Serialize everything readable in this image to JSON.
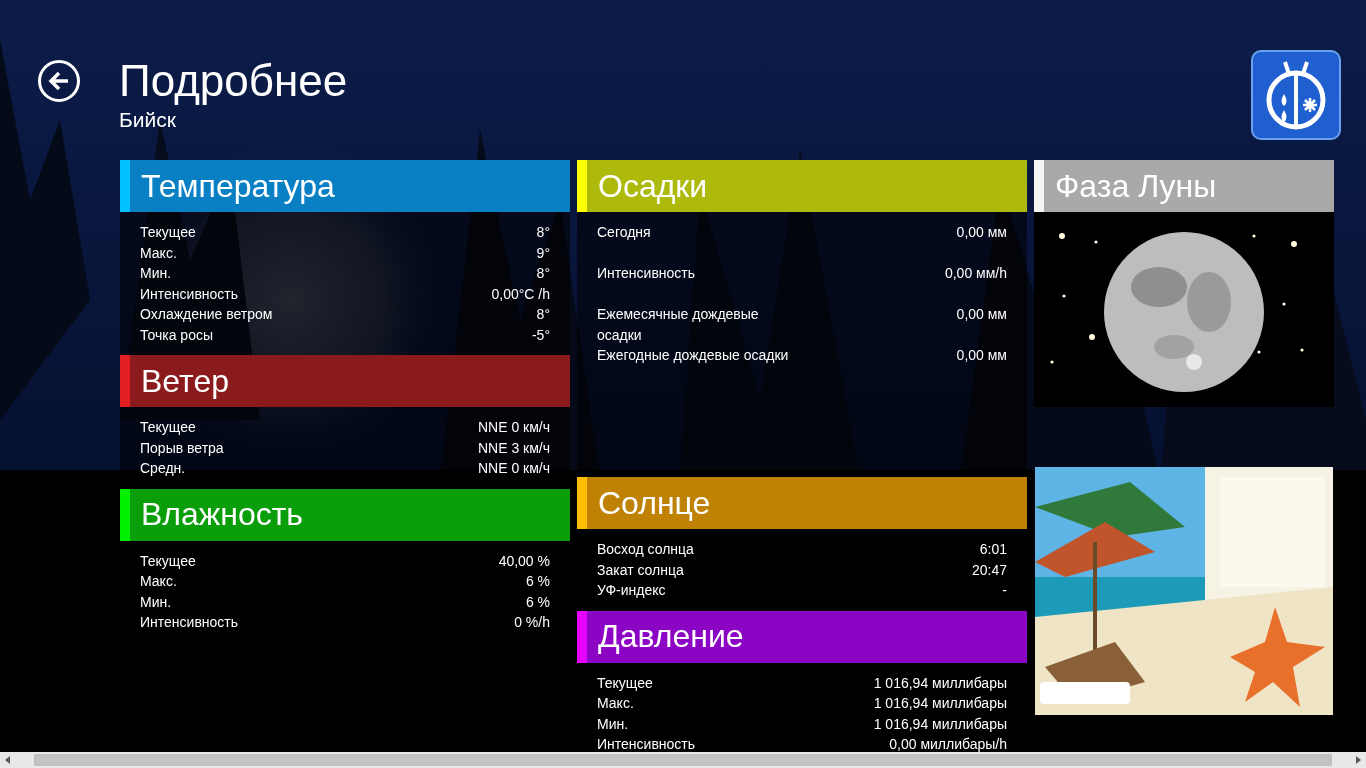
{
  "header": {
    "title": "Подробнее",
    "subtitle": "Бийск"
  },
  "columns": [
    {
      "sections": [
        {
          "kind": "stats",
          "title": "Температура",
          "color": "#0a80c4",
          "rows": [
            {
              "label": "Текущее",
              "value": "8°"
            },
            {
              "label": "Макс.",
              "value": "9°"
            },
            {
              "label": "Мин.",
              "value": "8°"
            },
            {
              "label": "Интенсивность",
              "value": "0,00°C /h"
            },
            {
              "label": "Охлаждение ветром",
              "value": "8°"
            },
            {
              "label": "Точка росы",
              "value": "-5°"
            }
          ]
        },
        {
          "kind": "stats",
          "title": "Ветер",
          "color": "#8a1a1c",
          "rows": [
            {
              "label": "Текущее",
              "value": "NNE 0 км/ч"
            },
            {
              "label": "Порыв ветра",
              "value": "NNE 3 км/ч"
            },
            {
              "label": "Средн.",
              "value": "NNE 0 км/ч"
            }
          ]
        },
        {
          "kind": "stats",
          "title": "Влажность",
          "color": "#0a9e0a",
          "rows": [
            {
              "label": "Текущее",
              "value": "40,00 %"
            },
            {
              "label": "Макс.",
              "value": "6 %"
            },
            {
              "label": "Мин.",
              "value": "6 %"
            },
            {
              "label": "Интенсивность",
              "value": "0 %/h"
            }
          ]
        }
      ]
    },
    {
      "sections": [
        {
          "kind": "spaced",
          "title": "Осадки",
          "color": "#adba0c",
          "rows": [
            {
              "label": "Сегодня",
              "value": "0,00 мм"
            },
            {
              "label": "Интенсивность",
              "value": "0,00 мм/h"
            },
            {
              "label": "Ежемесячные дождевые осадки",
              "value": "0,00 мм"
            },
            {
              "label": "Ежегодные дождевые осадки",
              "value": "0,00 мм"
            }
          ]
        },
        {
          "kind": "stats",
          "title": "Солнце",
          "color": "#c08204",
          "rows": [
            {
              "label": "Восход солнца",
              "value": "6:01"
            },
            {
              "label": "Закат солнца",
              "value": "20:47"
            },
            {
              "label": "УФ-индекс",
              "value": "-"
            }
          ]
        },
        {
          "kind": "stats",
          "title": "Давление",
          "color": "#8c04c4",
          "rows": [
            {
              "label": "Текущее",
              "value": "1 016,94 миллибары"
            },
            {
              "label": "Макс.",
              "value": "1 016,94 миллибары"
            },
            {
              "label": "Мин.",
              "value": "1 016,94 миллибары"
            },
            {
              "label": "Интенсивность",
              "value": "0,00 миллибары/h"
            }
          ]
        }
      ]
    },
    {
      "sections": [
        {
          "kind": "moon",
          "title": "Фаза Луны",
          "color": "#a9a9a9"
        },
        {
          "kind": "picture"
        }
      ]
    }
  ]
}
